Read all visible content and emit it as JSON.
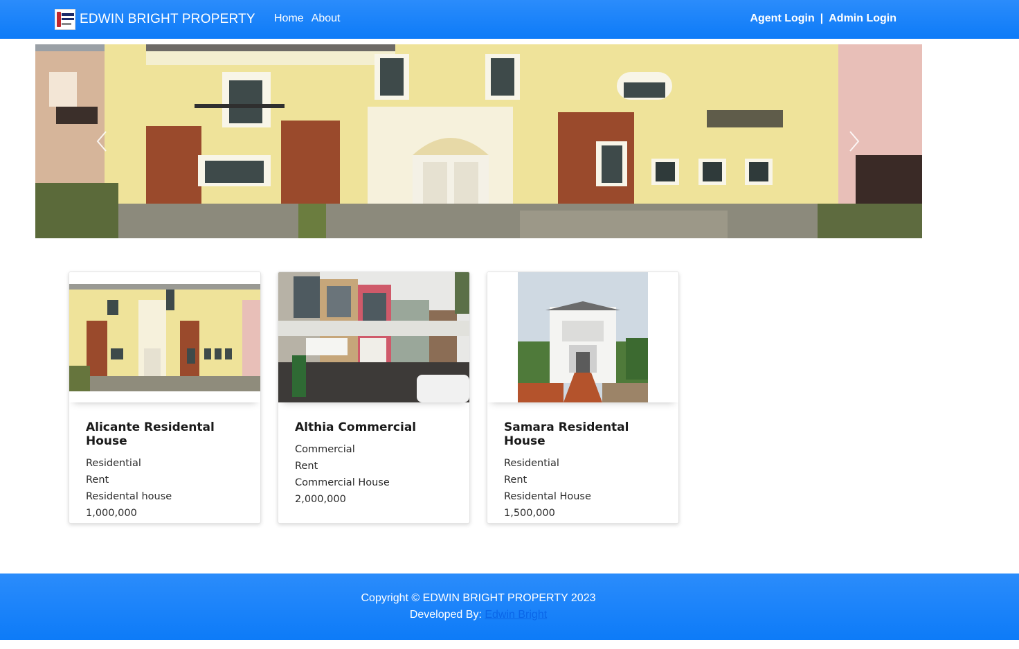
{
  "header": {
    "brand_name": "EDWIN BRIGHT PROPERTY",
    "brand_logo_icon": "company-logo",
    "nav": [
      {
        "label": "Home"
      },
      {
        "label": "About"
      }
    ],
    "agent_login": "Agent Login",
    "separator": "|",
    "admin_login": "Admin Login"
  },
  "carousel": {
    "prev_icon": "chevron-left-icon",
    "next_icon": "chevron-right-icon"
  },
  "properties": [
    {
      "name": "Alicante Residental House",
      "category": "Residential",
      "status": "Rent",
      "type": "Residental house",
      "price": "1,000,000"
    },
    {
      "name": "Althia Commercial",
      "category": "Commercial",
      "status": "Rent",
      "type": "Commercial House",
      "price": "2,000,000"
    },
    {
      "name": "Samara Residental House",
      "category": "Residential",
      "status": "Rent",
      "type": "Residental House",
      "price": "1,500,000"
    }
  ],
  "footer": {
    "copyright": "Copyright © EDWIN BRIGHT PROPERTY 2023",
    "developed_by_label": "Developed By:",
    "developer_name": "Edwin Bright"
  },
  "colors": {
    "primary": "#0d7bf8",
    "link": "#0a66e8"
  }
}
